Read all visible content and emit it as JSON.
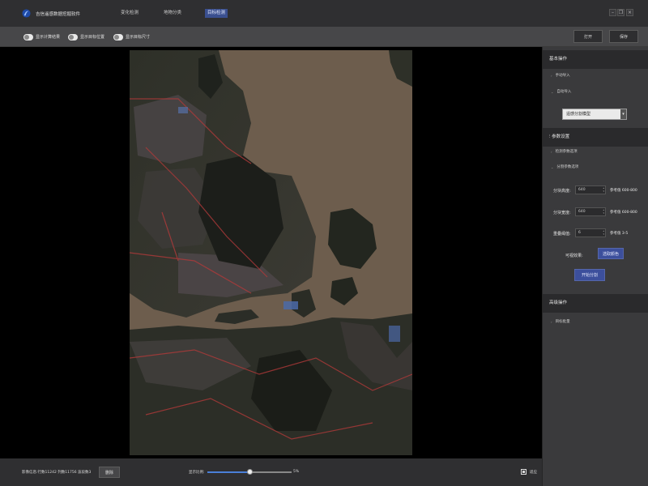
{
  "app": {
    "title": "吉信遥感数据挖掘软件",
    "nav_tabs": [
      {
        "label": "变化检测",
        "active": false
      },
      {
        "label": "地物分类",
        "active": false
      },
      {
        "label": "目标检测",
        "active": true
      }
    ],
    "window_controls": [
      "minimize-icon",
      "restore-icon",
      "close-icon"
    ]
  },
  "toolbar": {
    "toggles": [
      {
        "label": "显示计算结果",
        "on": true
      },
      {
        "label": "显示目标位置",
        "on": true
      },
      {
        "label": "显示目标尺寸",
        "on": true
      }
    ],
    "open_label": "打开",
    "save_label": "保存"
  },
  "panel": {
    "basic_ops": {
      "title": "基本操作",
      "items": [
        "手动导入",
        "自动导入"
      ]
    },
    "model_select": "遥感分割模型",
    "params": {
      "title": "参数设置",
      "items": [
        "检测参数选项",
        "分割参数选项"
      ],
      "fields": [
        {
          "label": "分块高度:",
          "value": "640",
          "ref": "参考值 600-800"
        },
        {
          "label": "分块宽度:",
          "value": "640",
          "ref": "参考值 600-800"
        },
        {
          "label": "重叠阈值:",
          "value": "6",
          "ref": "参考值 3-5"
        }
      ],
      "visual_color_label": "可视效果:",
      "pick_color_label": "选取颜色",
      "start_label": "开始分割"
    },
    "advanced_ops": {
      "title": "高级操作",
      "items": [
        "目标批量"
      ]
    }
  },
  "bottom": {
    "image_info": "影像信息:行数11242 列数11756 波段数3",
    "delete_label": "删除",
    "zoom_label": "显示比例:",
    "zoom_value": "5%",
    "zoom_fraction": 0.5,
    "fit_label": "适应"
  },
  "colors": {
    "active_tab": "#3a4f8f",
    "accent_button": "#3c4f9c",
    "slider_fill": "#4a7fd8"
  }
}
